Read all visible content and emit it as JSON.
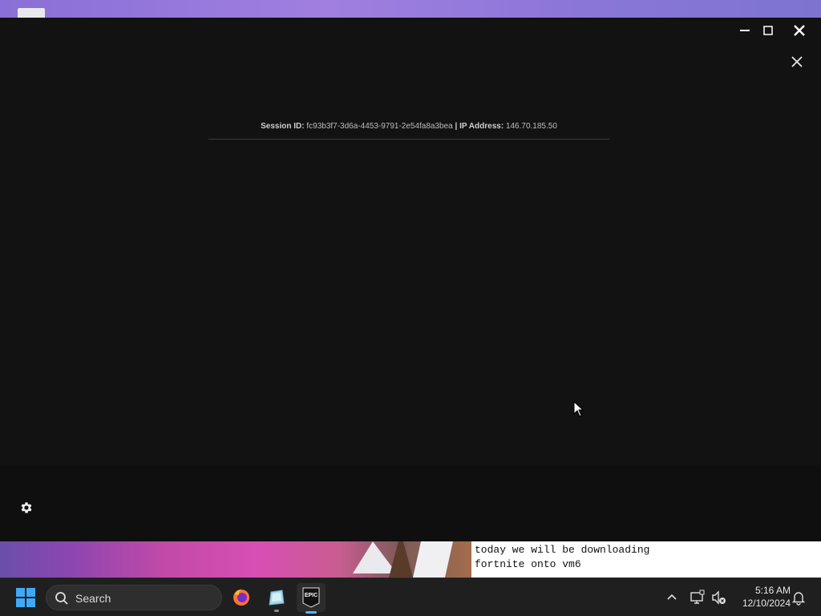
{
  "window": {
    "controls": [
      "minimize",
      "maximize",
      "close"
    ]
  },
  "session": {
    "id_label": "Session ID:",
    "id_value": "fc93b3f7-3d6a-4453-9791-2e54fa8a3bea",
    "separator": "|",
    "ip_label": "IP Address:",
    "ip_value": "146.70.185.50"
  },
  "caption": {
    "line1": "today we will be downloading",
    "line2": "fortnite onto vm6"
  },
  "taskbar": {
    "search_label": "Search",
    "apps": [
      "firefox-icon",
      "vm-app-icon",
      "epic-games-icon"
    ],
    "epic_label": "EPIC",
    "time": "5:16 AM",
    "date": "12/10/2024"
  },
  "colors": {
    "window_bg": "#121212",
    "taskbar_bg": "#1f1f1f",
    "accent": "#5bb4f0",
    "desktop": "#8a6fd6"
  }
}
